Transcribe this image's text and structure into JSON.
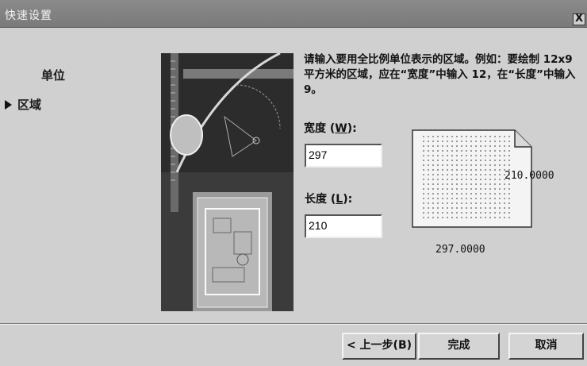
{
  "window": {
    "title": "快速设置",
    "close_label": "X"
  },
  "nav": {
    "items": [
      {
        "label": "单位"
      },
      {
        "label": "区域"
      }
    ],
    "active_index": 1
  },
  "main": {
    "instruction": "请输入要用全比例单位表示的区域。例如：要绘制 12x9 平方米的区域，应在“宽度”中输入 12，在“长度”中输入 9。",
    "width_field": {
      "label": "宽度",
      "hotkey": "W",
      "value": "297"
    },
    "length_field": {
      "label": "长度",
      "hotkey": "L",
      "value": "210"
    },
    "preview": {
      "height_text": "210.0000",
      "width_text": "297.0000"
    }
  },
  "buttons": {
    "back": "< 上一步(B)",
    "finish": "完成",
    "cancel": "取消"
  }
}
